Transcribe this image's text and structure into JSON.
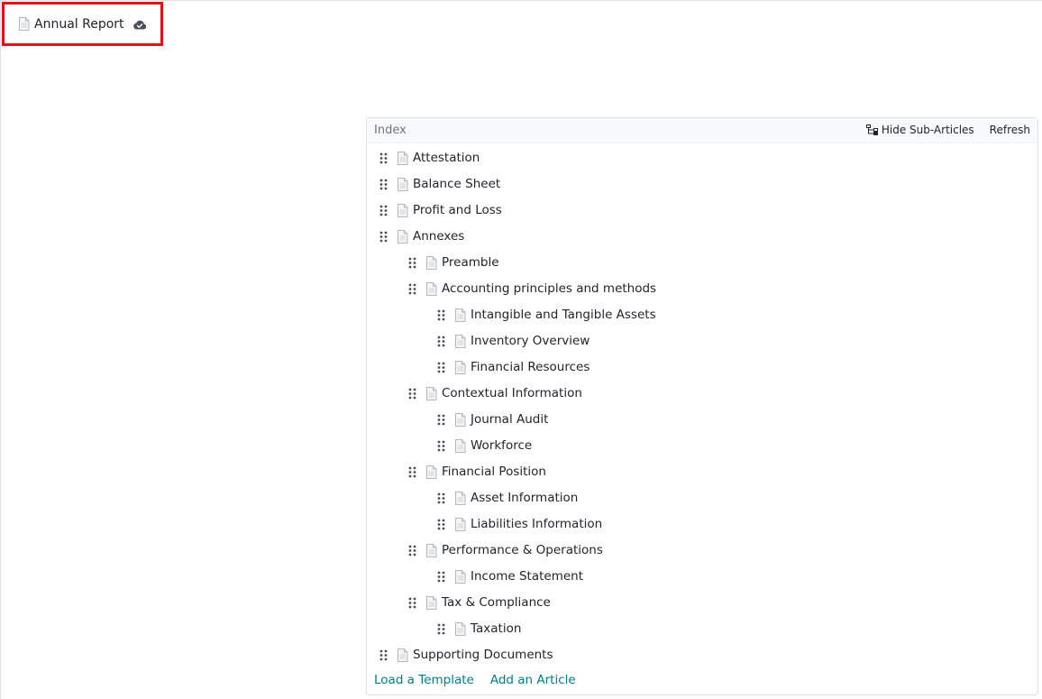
{
  "article": {
    "title": "Annual Report",
    "icon": "page-facing-up-icon",
    "sync_icon": "cloud-check-icon"
  },
  "index": {
    "label": "Index",
    "hide_sub_articles_label": "Hide Sub-Articles",
    "refresh_label": "Refresh",
    "items": [
      {
        "label": "Attestation",
        "level": 0
      },
      {
        "label": "Balance Sheet",
        "level": 0
      },
      {
        "label": "Profit and Loss",
        "level": 0
      },
      {
        "label": "Annexes",
        "level": 0
      },
      {
        "label": "Preamble",
        "level": 1
      },
      {
        "label": "Accounting principles and methods",
        "level": 1
      },
      {
        "label": "Intangible and Tangible Assets",
        "level": 2
      },
      {
        "label": "Inventory Overview",
        "level": 2
      },
      {
        "label": "Financial Resources",
        "level": 2
      },
      {
        "label": "Contextual Information",
        "level": 1
      },
      {
        "label": "Journal Audit",
        "level": 2
      },
      {
        "label": "Workforce",
        "level": 2
      },
      {
        "label": "Financial Position",
        "level": 1
      },
      {
        "label": "Asset Information",
        "level": 2
      },
      {
        "label": "Liabilities Information",
        "level": 2
      },
      {
        "label": "Performance & Operations",
        "level": 1
      },
      {
        "label": "Income Statement",
        "level": 2
      },
      {
        "label": "Tax & Compliance",
        "level": 1
      },
      {
        "label": "Taxation",
        "level": 2
      },
      {
        "label": "Supporting Documents",
        "level": 0
      }
    ],
    "footer": {
      "load_template_label": "Load a Template",
      "add_article_label": "Add an Article"
    }
  },
  "colors": {
    "highlight_border": "#e0131b",
    "link": "#017e84",
    "muted": "#6c757d"
  }
}
